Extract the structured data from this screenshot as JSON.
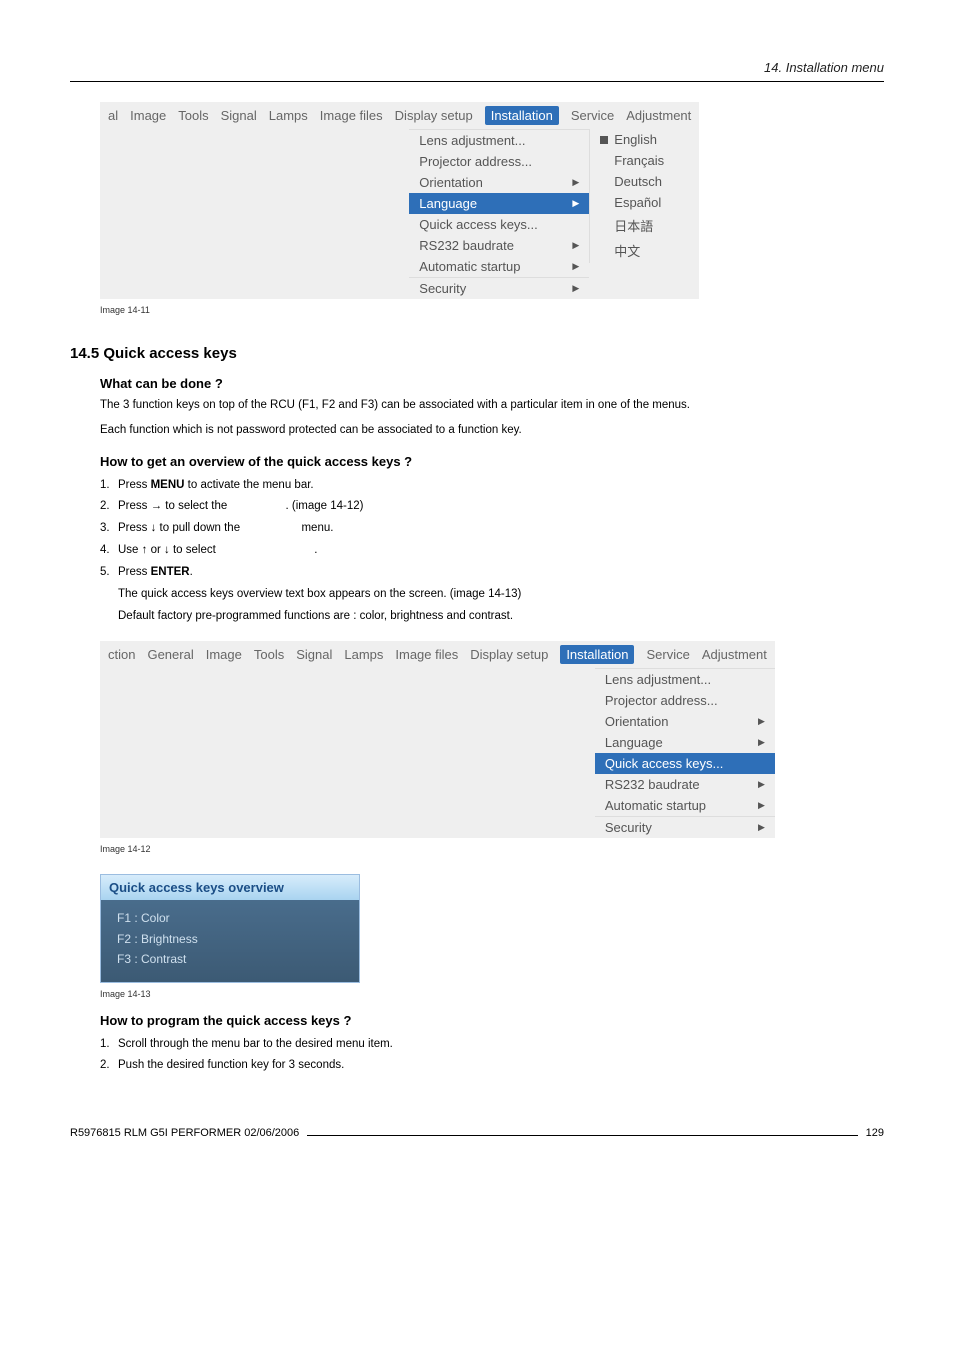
{
  "header": {
    "title": "14.  Installation menu"
  },
  "menu1": {
    "bar": [
      "al",
      "Image",
      "Tools",
      "Signal",
      "Lamps",
      "Image files",
      "Display setup",
      "Installation",
      "Service",
      "Adjustment"
    ],
    "sel": "Installation",
    "items": [
      {
        "label": "Lens adjustment...",
        "arrow": false
      },
      {
        "label": "Projector address...",
        "arrow": false
      },
      {
        "label": "Orientation",
        "arrow": true
      },
      {
        "label": "Language",
        "arrow": true,
        "sel": true
      },
      {
        "label": "Quick access keys...",
        "arrow": false
      },
      {
        "label": "RS232 baudrate",
        "arrow": true
      },
      {
        "label": "Automatic startup",
        "arrow": true
      },
      {
        "label": "Security",
        "arrow": true
      }
    ],
    "sub": [
      "English",
      "Français",
      "Deutsch",
      "Español",
      "日本語",
      "中文"
    ],
    "subSelIdx": 0
  },
  "caption1": "Image 14-11",
  "section": "14.5  Quick access keys",
  "sub_whatcan": "What can be done ?",
  "p_whatcan1": "The 3 function keys on top of the RCU (F1, F2 and F3) can be associated with a particular item in one of the menus.",
  "p_whatcan2": "Each function which is not password protected can be associated to a function key.",
  "sub_over": "How to get an overview of the quick access keys ?",
  "steps_over": [
    {
      "n": "1.",
      "pre": "Press ",
      "b": "MENU",
      "post": " to activate the menu bar."
    },
    {
      "n": "2.",
      "pre": "Press → to select the ",
      "post": ".  (image 14-12)"
    },
    {
      "n": "3.",
      "pre": "Press ↓ to pull down the ",
      "post": " menu."
    },
    {
      "n": "4.",
      "pre": "Use ↑ or ↓ to select ",
      "post": "."
    },
    {
      "n": "5.",
      "pre": "Press ",
      "b": "ENTER",
      "post": "."
    }
  ],
  "step5_sub1": "The quick access keys overview text box appears on the screen.  (image 14-13)",
  "step5_sub2": "Default factory pre-programmed functions are :  color, brightness and contrast.",
  "menu2": {
    "bar": [
      "ction",
      "General",
      "Image",
      "Tools",
      "Signal",
      "Lamps",
      "Image files",
      "Display setup",
      "Installation",
      "Service",
      "Adjustment"
    ],
    "sel": "Installation",
    "items": [
      {
        "label": "Lens adjustment...",
        "arrow": false
      },
      {
        "label": "Projector address...",
        "arrow": false
      },
      {
        "label": "Orientation",
        "arrow": true
      },
      {
        "label": "Language",
        "arrow": true
      },
      {
        "label": "Quick access keys...",
        "arrow": false,
        "sel": true
      },
      {
        "label": "RS232 baudrate",
        "arrow": true
      },
      {
        "label": "Automatic startup",
        "arrow": true
      },
      {
        "label": "Security",
        "arrow": true
      }
    ]
  },
  "caption2": "Image 14-12",
  "popup": {
    "title": "Quick access keys overview",
    "rows": [
      "F1 : Color",
      "F2 : Brightness",
      "F3 : Contrast"
    ]
  },
  "caption3": "Image 14-13",
  "sub_prog": "How to program the quick access keys ?",
  "steps_prog": [
    {
      "n": "1.",
      "txt": "Scroll through the menu bar to the desired menu item."
    },
    {
      "n": "2.",
      "txt": "Push the desired function key for 3 seconds."
    }
  ],
  "footer": {
    "left": "R5976815   RLM G5I PERFORMER   02/06/2006",
    "right": "129"
  }
}
